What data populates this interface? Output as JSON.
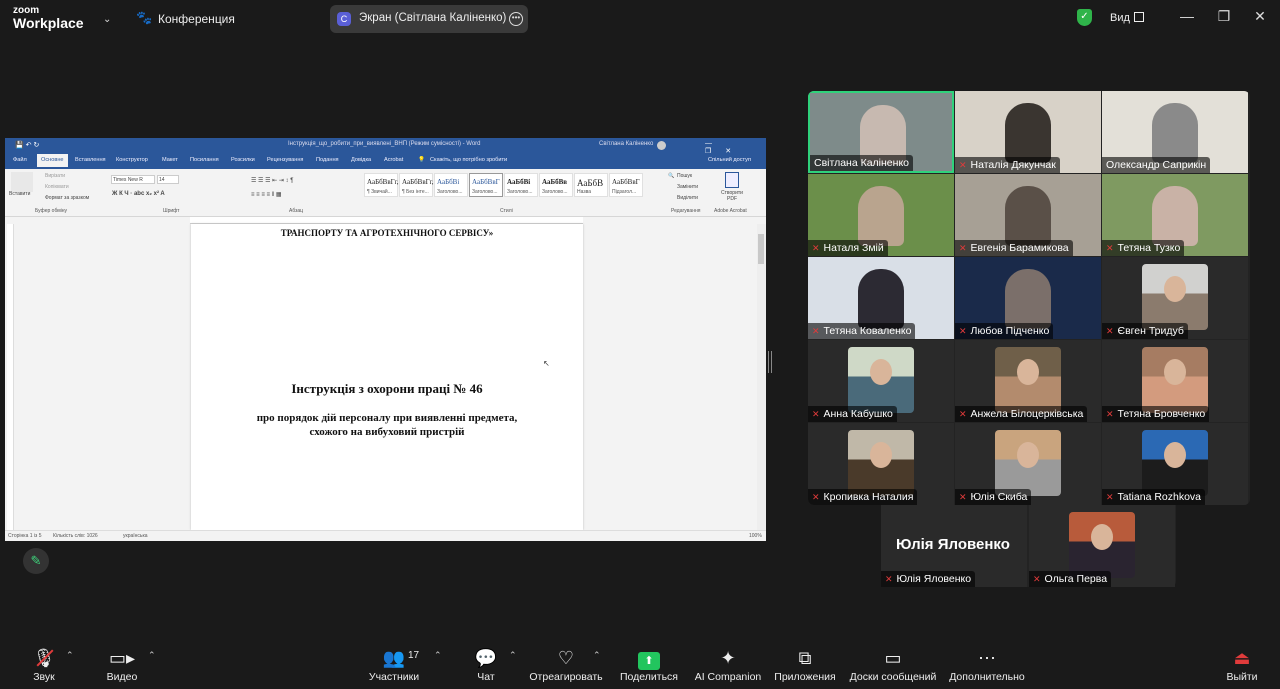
{
  "topbar": {
    "logo_line1": "zoom",
    "logo_line2": "Workplace",
    "meeting_label": "Конференция",
    "share_pill": {
      "avatar_letter": "С",
      "label": "Экран (Світлана Каліненко)"
    },
    "view_label": "Вид",
    "window_buttons": {
      "minimize": "—",
      "maximize": "❐",
      "close": "✕"
    }
  },
  "word": {
    "title": "Інструкція_що_робити_при_виявлені_ВНП (Режим сумісності) - Word",
    "user": "Світлана Каліненко",
    "tabs": [
      "Файл",
      "Основне",
      "Вставлення",
      "Конструктор",
      "Макет",
      "Посилання",
      "Розсилки",
      "Рецензування",
      "Подання",
      "Довідка",
      "Acrobat"
    ],
    "tell_me": "Скажіть, що потрібно зробити",
    "share": "Спільний доступ",
    "ribbon": {
      "paste": "Вставити",
      "cut": "Вирізати",
      "copy": "Копіювати",
      "format_painter": "Формат за зразком",
      "clipboard": "Буфер обміну",
      "font_name": "Times New R",
      "font_size": "14",
      "font_group": "Шрифт",
      "paragraph_group": "Абзац",
      "styles_group": "Стилі",
      "styles": [
        {
          "sample": "АаБбВвГг,",
          "name": "¶ Звичай..."
        },
        {
          "sample": "АаБбВвГг,",
          "name": "¶ Без інте..."
        },
        {
          "sample": "АаБбВі",
          "name": "Заголово..."
        },
        {
          "sample": "АаБбВвГ",
          "name": "Заголово..."
        },
        {
          "sample": "АаБбВі",
          "name": "Заголово..."
        },
        {
          "sample": "АаБбВв",
          "name": "Заголово..."
        },
        {
          "sample": "АаБбВ",
          "name": "Назва"
        },
        {
          "sample": "АаБбВвГ",
          "name": "Підзагол..."
        }
      ],
      "find": "Пошук",
      "replace": "Замінити",
      "select": "Виділити",
      "editing_group": "Редагування",
      "create_pdf": "Створити PDF",
      "acrobat_group": "Adobe Acrobat"
    },
    "document": {
      "line_top": "ТРАНСПОРТУ ТА АГРОТЕХНІЧНОГО СЕРВІСУ»",
      "heading": "Інструкція з охорони праці № 46",
      "sub1": "про порядок дій персоналу при виявленні предмета,",
      "sub2": "схожого на вибуховий пристрій"
    },
    "status": {
      "page": "Сторінка 1 із 5",
      "words": "Кількість слів: 1026",
      "lang": "українська",
      "zoom": "100%"
    }
  },
  "participants": [
    {
      "name": "Світлана Каліненко",
      "muted": false,
      "active": true,
      "kind": "video"
    },
    {
      "name": "Наталія Дякунчак",
      "muted": true,
      "kind": "video"
    },
    {
      "name": "Олександр Саприкін",
      "muted": false,
      "kind": "video"
    },
    {
      "name": "Наталя Змій",
      "muted": true,
      "kind": "video"
    },
    {
      "name": "Евгенія Барамикова",
      "muted": true,
      "kind": "video"
    },
    {
      "name": "Тетяна Тузко",
      "muted": true,
      "kind": "video"
    },
    {
      "name": "Тетяна  Коваленко",
      "muted": true,
      "kind": "video"
    },
    {
      "name": "Любов Підченко",
      "muted": true,
      "kind": "video"
    },
    {
      "name": "Євген Тридуб",
      "muted": true,
      "kind": "avatar"
    },
    {
      "name": "Анна Кабушко",
      "muted": true,
      "kind": "avatar"
    },
    {
      "name": "Анжела Білоцерківська",
      "muted": true,
      "kind": "avatar"
    },
    {
      "name": "Тетяна Бровченко",
      "muted": true,
      "kind": "avatar"
    },
    {
      "name": "Кропивка Наталия",
      "muted": true,
      "kind": "avatar"
    },
    {
      "name": "Юлія Скиба",
      "muted": true,
      "kind": "avatar"
    },
    {
      "name": "Tatiana Rozhkova",
      "muted": true,
      "kind": "avatar"
    },
    {
      "name": "Юлія Яловенко",
      "muted": true,
      "kind": "text",
      "big_name": "Юлія Яловенко"
    },
    {
      "name": "Ольга Перва",
      "muted": true,
      "kind": "avatar"
    }
  ],
  "toolbar": {
    "audio": "Звук",
    "video": "Видео",
    "participants": "Участники",
    "participants_count": "17",
    "chat": "Чат",
    "react": "Отреагировать",
    "share": "Поделиться",
    "ai": "AI Companion",
    "apps": "Приложения",
    "whiteboards": "Доски сообщений",
    "more": "Дополнительно",
    "leave": "Выйти"
  },
  "colors": {
    "bg": "#1a1a1a",
    "word_blue": "#2b579a",
    "share_green": "#22c55e",
    "active_speaker": "#2fd27b",
    "muted_red": "#e03b3b"
  }
}
